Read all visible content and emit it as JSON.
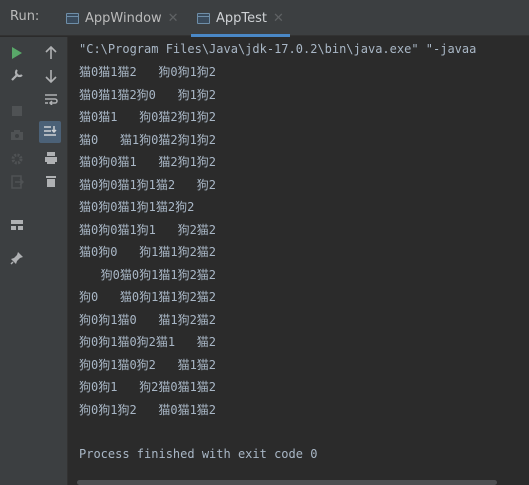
{
  "toolwindow": {
    "run_label": "Run:",
    "tabs": [
      {
        "label": "AppWindow",
        "active": false
      },
      {
        "label": "AppTest",
        "active": true
      }
    ]
  },
  "toolbar_icons": [
    "rerun-icon",
    "wrench-icon",
    "stop-icon",
    "camera-icon",
    "settings-icon",
    "exit-icon",
    "layout-icon",
    "pin-icon",
    "up-arrow-icon",
    "down-arrow-icon",
    "soft-wrap-icon",
    "scroll-to-end-icon",
    "print-icon",
    "trash-icon"
  ],
  "console": {
    "command_line": "\"C:\\Program Files\\Java\\jdk-17.0.2\\bin\\java.exe\" \"-javaa",
    "output_lines": [
      "猫0猫1猫2   狗0狗1狗2",
      "猫0猫1猫2狗0   狗1狗2",
      "猫0猫1   狗0猫2狗1狗2",
      "猫0   猫1狗0猫2狗1狗2",
      "猫0狗0猫1   猫2狗1狗2",
      "猫0狗0猫1狗1猫2   狗2",
      "猫0狗0猫1狗1猫2狗2",
      "猫0狗0猫1狗1   狗2猫2",
      "猫0狗0   狗1猫1狗2猫2",
      "   狗0猫0狗1猫1狗2猫2",
      "狗0   猫0狗1猫1狗2猫2",
      "狗0狗1猫0   猫1狗2猫2",
      "狗0狗1猫0狗2猫1   猫2",
      "狗0狗1猫0狗2   猫1猫2",
      "狗0狗1   狗2猫0猫1猫2",
      "狗0狗1狗2   猫0猫1猫2"
    ],
    "exit_message": "Process finished with exit code 0"
  },
  "colors": {
    "background": "#2b2b2b",
    "toolbar": "#3c3f41",
    "text": "#a9b7c6",
    "run_green": "#59a869",
    "accent_blue": "#4a88c7"
  }
}
